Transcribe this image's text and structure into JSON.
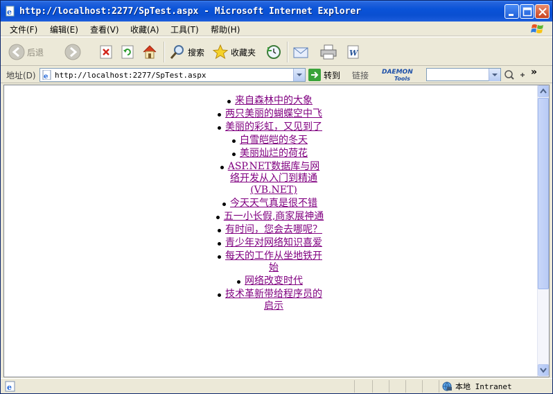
{
  "window": {
    "title": "http://localhost:2277/SpTest.aspx - Microsoft Internet Explorer"
  },
  "menu": {
    "items": [
      "文件(F)",
      "编辑(E)",
      "查看(V)",
      "收藏(A)",
      "工具(T)",
      "帮助(H)"
    ]
  },
  "toolbar": {
    "back_label": "后退",
    "search_label": "搜索",
    "favorites_label": "收藏夹"
  },
  "address": {
    "label": "地址(D)",
    "url": "http://localhost:2277/SpTest.aspx",
    "go_label": "转到",
    "links_label": "链接",
    "daemon_line1": "DAEMON",
    "daemon_line2": "Tools"
  },
  "content": {
    "items": [
      "来自森林中的大象",
      "两只美丽的蝴蝶空中飞",
      "美丽的彩虹，又见到了",
      "白雪皑皑的冬天",
      "美丽灿烂的荷花",
      "ASP.NET数据库与网络开发从入门到精通(VB.NET)",
      "今天天气真是很不错",
      "五一小长假,商家展神通",
      "有时间，您会去哪呢？",
      "青少年对网络知识喜爱",
      "每天的工作从坐地铁开始",
      "网络改变时代",
      "技术革新带给程序员的启示"
    ]
  },
  "status": {
    "zone": "本地 Intranet"
  },
  "colors": {
    "link_visited": "#800080",
    "titlebar": "#0a53d8"
  }
}
